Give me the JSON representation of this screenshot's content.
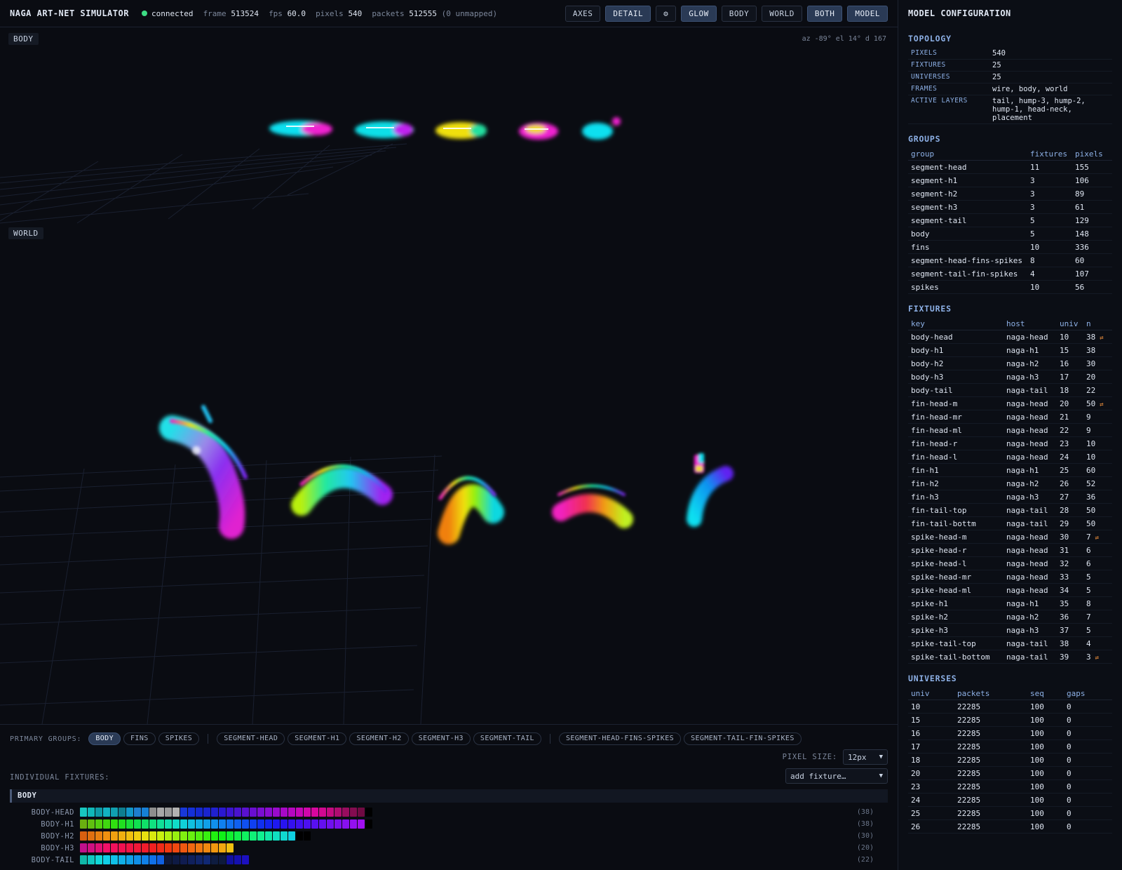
{
  "topbar": {
    "title": "NAGA ART-NET SIMULATOR",
    "status": "connected",
    "frame_label": "frame",
    "frame": "513524",
    "fps_label": "fps",
    "fps": "60.0",
    "pixels_label": "pixels",
    "pixels": "540",
    "packets_label": "packets",
    "packets": "512555",
    "unmapped": "(0 unmapped)",
    "buttons": [
      "AXES",
      "DETAIL",
      "⚙",
      "GLOW",
      "BODY",
      "WORLD",
      "BOTH",
      "MODEL"
    ],
    "active_buttons": [
      "DETAIL",
      "GLOW",
      "BOTH",
      "MODEL"
    ]
  },
  "viewport": {
    "body_label": "BODY",
    "world_label": "WORLD",
    "camera": "az -89° el 14° d 167"
  },
  "controls": {
    "primary_groups_label": "PRIMARY GROUPS:",
    "chips": [
      "BODY",
      "FINS",
      "SPIKES",
      "SEGMENT-HEAD",
      "SEGMENT-H1",
      "SEGMENT-H2",
      "SEGMENT-H3",
      "SEGMENT-TAIL",
      "SEGMENT-HEAD-FINS-SPIKES",
      "SEGMENT-TAIL-FIN-SPIKES"
    ],
    "active_chip": "BODY",
    "pixel_size_label": "PIXEL SIZE:",
    "pixel_size": "12px",
    "individual_fixtures_label": "INDIVIDUAL FIXTURES:",
    "add_fixture": "add fixture…",
    "body_header": "BODY",
    "fixtures": [
      {
        "name": "BODY-HEAD",
        "count": "(38)",
        "colors": [
          "#18c8c0",
          "#10b8b8",
          "#0e9aa6",
          "#12b2c2",
          "#10a0b0",
          "#0e7e90",
          "#1096c8",
          "#1e7ed0",
          "#1680d6",
          "#8e8e8e",
          "#a8a8a8",
          "#9a9a9a",
          "#b2b2b2",
          "#1838d8",
          "#1430d8",
          "#1428d0",
          "#1a24d0",
          "#2020d0",
          "#2a18d0",
          "#3a14d0",
          "#4a12d0",
          "#5a10d0",
          "#6a0ed0",
          "#7a0ed0",
          "#8a0cd0",
          "#9a0acc",
          "#a808c8",
          "#b606c0",
          "#c406b8",
          "#d006ac",
          "#d8069e",
          "#d20890",
          "#c40a80",
          "#b00c70",
          "#980c5e",
          "#840c50",
          "#700a42",
          "#000000"
        ]
      },
      {
        "name": "BODY-H1",
        "count": "(38)",
        "colors": [
          "#6ab010",
          "#60c010",
          "#52d010",
          "#40d810",
          "#30e010",
          "#20e020",
          "#18e038",
          "#10e050",
          "#10e068",
          "#10e080",
          "#10e098",
          "#10e0b0",
          "#10dcc8",
          "#10d0d8",
          "#10c0e0",
          "#10b0e4",
          "#10a0e8",
          "#1090ec",
          "#1080f0",
          "#1070f0",
          "#1060f0",
          "#1050f0",
          "#1040f0",
          "#1030f0",
          "#1424f0",
          "#1e18f0",
          "#2814f0",
          "#3410f0",
          "#4010f0",
          "#4c10f0",
          "#5810f0",
          "#6410f0",
          "#7010f0",
          "#7c10f0",
          "#8810f0",
          "#9410f0",
          "#a010f0",
          "#000000"
        ]
      },
      {
        "name": "BODY-H2",
        "count": "(30)",
        "colors": [
          "#d86010",
          "#e07010",
          "#e88010",
          "#f09010",
          "#f0a010",
          "#f0b010",
          "#f0c010",
          "#f0d010",
          "#e8e010",
          "#d8e810",
          "#c8f010",
          "#b0f010",
          "#98f010",
          "#80f010",
          "#68f010",
          "#50f010",
          "#38f010",
          "#20f010",
          "#10f018",
          "#10f030",
          "#10f048",
          "#10f060",
          "#10f078",
          "#10f090",
          "#10e8a8",
          "#10e0c0",
          "#10d8d0",
          "#10d0e0",
          "#000000",
          "#000000"
        ]
      },
      {
        "name": "BODY-H3",
        "count": "(20)",
        "colors": [
          "#c0108c",
          "#d01080",
          "#e01074",
          "#f01068",
          "#f0105c",
          "#f01050",
          "#f01444",
          "#f01838",
          "#f01c2c",
          "#f02020",
          "#f02c18",
          "#f03810",
          "#f04810",
          "#f05810",
          "#f06810",
          "#f07810",
          "#f08810",
          "#f09810",
          "#f0a810",
          "#f0c010"
        ]
      },
      {
        "name": "BODY-TAIL",
        "count": "(22)",
        "colors": [
          "#10b8a8",
          "#10c8c0",
          "#10d8d8",
          "#10d0e8",
          "#10c0e8",
          "#10b0e8",
          "#10a0e8",
          "#1090e8",
          "#1080e8",
          "#1070e8",
          "#1060e0",
          "#0e1838",
          "#0e1a44",
          "#101c50",
          "#10205c",
          "#102468",
          "#102874",
          "#0e1c40",
          "#0e1a3c",
          "#1010a0",
          "#1410b0",
          "#1c10c0"
        ]
      }
    ]
  },
  "model": {
    "title": "MODEL CONFIGURATION",
    "topology_title": "TOPOLOGY",
    "topology": [
      {
        "k": "PIXELS",
        "v": "540"
      },
      {
        "k": "FIXTURES",
        "v": "25"
      },
      {
        "k": "UNIVERSES",
        "v": "25"
      },
      {
        "k": "FRAMES",
        "v": "wire, body, world"
      },
      {
        "k": "ACTIVE LAYERS",
        "v": "tail, hump-3, hump-2, hump-1, head-neck, placement"
      }
    ],
    "groups_title": "GROUPS",
    "groups_headers": [
      "group",
      "fixtures",
      "pixels"
    ],
    "groups": [
      [
        "segment-head",
        "11",
        "155"
      ],
      [
        "segment-h1",
        "3",
        "106"
      ],
      [
        "segment-h2",
        "3",
        "89"
      ],
      [
        "segment-h3",
        "3",
        "61"
      ],
      [
        "segment-tail",
        "5",
        "129"
      ],
      [
        "body",
        "5",
        "148"
      ],
      [
        "fins",
        "10",
        "336"
      ],
      [
        "segment-head-fins-spikes",
        "8",
        "60"
      ],
      [
        "segment-tail-fin-spikes",
        "4",
        "107"
      ],
      [
        "spikes",
        "10",
        "56"
      ]
    ],
    "fixtures_title": "FIXTURES",
    "fixtures_headers": [
      "key",
      "host",
      "univ",
      "n"
    ],
    "fixtures": [
      [
        "body-head",
        "naga-head",
        "10",
        "38",
        "⇄"
      ],
      [
        "body-h1",
        "naga-h1",
        "15",
        "38",
        ""
      ],
      [
        "body-h2",
        "naga-h2",
        "16",
        "30",
        ""
      ],
      [
        "body-h3",
        "naga-h3",
        "17",
        "20",
        ""
      ],
      [
        "body-tail",
        "naga-tail",
        "18",
        "22",
        ""
      ],
      [
        "fin-head-m",
        "naga-head",
        "20",
        "50",
        "⇄"
      ],
      [
        "fin-head-mr",
        "naga-head",
        "21",
        "9",
        ""
      ],
      [
        "fin-head-ml",
        "naga-head",
        "22",
        "9",
        ""
      ],
      [
        "fin-head-r",
        "naga-head",
        "23",
        "10",
        ""
      ],
      [
        "fin-head-l",
        "naga-head",
        "24",
        "10",
        ""
      ],
      [
        "fin-h1",
        "naga-h1",
        "25",
        "60",
        ""
      ],
      [
        "fin-h2",
        "naga-h2",
        "26",
        "52",
        ""
      ],
      [
        "fin-h3",
        "naga-h3",
        "27",
        "36",
        ""
      ],
      [
        "fin-tail-top",
        "naga-tail",
        "28",
        "50",
        ""
      ],
      [
        "fin-tail-bottm",
        "naga-tail",
        "29",
        "50",
        ""
      ],
      [
        "spike-head-m",
        "naga-head",
        "30",
        "7",
        "⇄"
      ],
      [
        "spike-head-r",
        "naga-head",
        "31",
        "6",
        ""
      ],
      [
        "spike-head-l",
        "naga-head",
        "32",
        "6",
        ""
      ],
      [
        "spike-head-mr",
        "naga-head",
        "33",
        "5",
        ""
      ],
      [
        "spike-head-ml",
        "naga-head",
        "34",
        "5",
        ""
      ],
      [
        "spike-h1",
        "naga-h1",
        "35",
        "8",
        ""
      ],
      [
        "spike-h2",
        "naga-h2",
        "36",
        "7",
        ""
      ],
      [
        "spike-h3",
        "naga-h3",
        "37",
        "5",
        ""
      ],
      [
        "spike-tail-top",
        "naga-tail",
        "38",
        "4",
        ""
      ],
      [
        "spike-tail-bottom",
        "naga-tail",
        "39",
        "3",
        "⇄"
      ]
    ],
    "universes_title": "UNIVERSES",
    "universes_headers": [
      "univ",
      "packets",
      "seq",
      "gaps"
    ],
    "universes": [
      [
        "10",
        "22285",
        "100",
        "0"
      ],
      [
        "15",
        "22285",
        "100",
        "0"
      ],
      [
        "16",
        "22285",
        "100",
        "0"
      ],
      [
        "17",
        "22285",
        "100",
        "0"
      ],
      [
        "18",
        "22285",
        "100",
        "0"
      ],
      [
        "20",
        "22285",
        "100",
        "0"
      ],
      [
        "23",
        "22285",
        "100",
        "0"
      ],
      [
        "24",
        "22285",
        "100",
        "0"
      ],
      [
        "25",
        "22285",
        "100",
        "0"
      ],
      [
        "26",
        "22285",
        "100",
        "0"
      ]
    ]
  }
}
